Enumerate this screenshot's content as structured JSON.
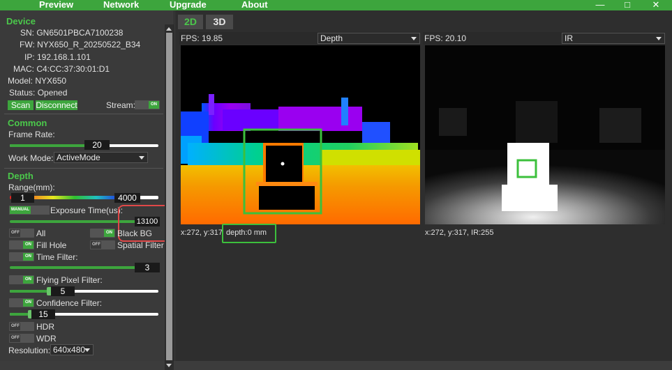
{
  "menu": {
    "items": [
      "Preview",
      "Network",
      "Upgrade",
      "About"
    ],
    "minimize": "—",
    "maximize": "□",
    "close": "✕"
  },
  "device": {
    "title": "Device",
    "sn": "SN: GN6501PBCA7100238",
    "fw": "FW: NYX650_R_20250522_B34",
    "ip": "IP: 192.168.1.101",
    "mac": "MAC: C4:CC:37:30:01:D1",
    "model": "Model: NYX650",
    "status": "Status: Opened",
    "scan_label": "Scan",
    "disconnect_label": "Disconnect",
    "stream_label": "Stream:",
    "stream_toggle": "ON"
  },
  "common": {
    "title": "Common",
    "frame_rate_label": "Frame Rate:",
    "frame_rate_value": "20",
    "frame_rate_fraction": 0.55,
    "work_mode_label": "Work Mode:",
    "work_mode_value": "ActiveMode"
  },
  "depth": {
    "title": "Depth",
    "range_label": "Range(mm):",
    "range_min": "1",
    "range_max": "4000",
    "exposure_mode": "MANUAL",
    "exposure_label": "Exposure Time(us):",
    "exposure_value": "13100",
    "all_toggle": "OFF",
    "all_label": "All",
    "black_bg_toggle": "ON",
    "black_bg_label": "Black BG",
    "fill_hole_toggle": "ON",
    "fill_hole_label": "Fill Hole",
    "spatial_toggle": "OFF",
    "spatial_label": "Spatial Filter",
    "time_filter_toggle": "ON",
    "time_filter_label": "Time Filter:",
    "time_filter_value": "3",
    "flying_toggle": "ON",
    "flying_label": "Flying Pixel Filter:",
    "flying_value": "5",
    "confidence_toggle": "ON",
    "confidence_label": "Confidence Filter:",
    "confidence_value": "15",
    "hdr_toggle": "OFF",
    "hdr_label": "HDR",
    "wdr_toggle": "OFF",
    "wdr_label": "WDR",
    "resolution_label": "Resolution:",
    "resolution_value": "640x480"
  },
  "tabs": [
    "2D",
    "3D"
  ],
  "left_view": {
    "fps": "FPS: 19.85",
    "mode": "Depth",
    "coord": "x:272, y:317",
    "depth_readout": "depth:0 mm"
  },
  "right_view": {
    "fps": "FPS: 20.10",
    "mode": "IR",
    "coord": "x:272, y:317, IR:255"
  },
  "colors": {
    "accent": "#3da53d",
    "highlight_red": "#e04848",
    "highlight_green": "#3cc03c"
  }
}
